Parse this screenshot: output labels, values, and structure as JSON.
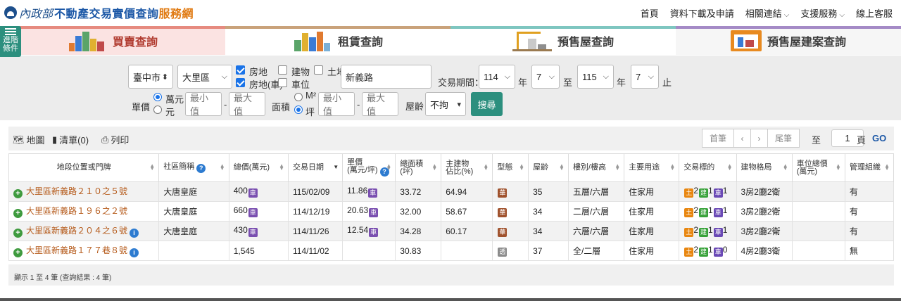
{
  "header": {
    "agency": "內政部",
    "title_main": "不動產交易實價查詢",
    "title_accent": "服務網",
    "nav": [
      {
        "label": "首頁",
        "dropdown": false
      },
      {
        "label": "資料下載及申請",
        "dropdown": false
      },
      {
        "label": "相關連結",
        "dropdown": true
      },
      {
        "label": "支援服務",
        "dropdown": true
      },
      {
        "label": "線上客服",
        "dropdown": false
      }
    ]
  },
  "adv_filter": {
    "line1": "進階",
    "line2": "條件"
  },
  "tabs": [
    {
      "label": "買賣查詢",
      "active": true
    },
    {
      "label": "租賃查詢",
      "active": false
    },
    {
      "label": "預售屋查詢",
      "active": false
    },
    {
      "label": "預售屋建案查詢",
      "active": false
    }
  ],
  "search": {
    "city": "臺中市",
    "district": "大里區",
    "types": {
      "house_land": {
        "label": "房地",
        "checked": true
      },
      "building": {
        "label": "建物",
        "checked": false
      },
      "land": {
        "label": "土地",
        "checked": false
      },
      "house_land_car": {
        "label": "房地(車)",
        "checked": true
      },
      "parking": {
        "label": "車位",
        "checked": false
      }
    },
    "keyword": "新義路",
    "period_label": "交易期間：",
    "from_year": "114",
    "from_month": "7",
    "to_year": "115",
    "to_month": "7",
    "year_suffix": "年",
    "to_word": "至",
    "end_word": "止",
    "price_label": "單價",
    "unit_wan": "萬元",
    "unit_yuan": "元",
    "min_placeholder": "最小值",
    "max_placeholder": "最大值",
    "dash": "-",
    "area_label": "面積",
    "unit_m2": "M²",
    "unit_ping": "坪",
    "age_label": "屋齡",
    "age_value": "不拘",
    "search_button": "搜尋"
  },
  "toolbar": {
    "map": "地圖",
    "list": "清單(0)",
    "print": "列印",
    "first": "首筆",
    "prev": "‹",
    "next": "›",
    "last": "尾筆",
    "goto_label": "至",
    "page": "1",
    "page_suffix": "頁",
    "go": "GO"
  },
  "table": {
    "headers": [
      "地段位置或門牌",
      "社區簡稱",
      "總價(萬元)",
      "交易日期",
      "單價\n(萬元/坪)",
      "總面積\n(坪)",
      "主建物\n佔比(%)",
      "型態",
      "屋齡",
      "樓別/樓高",
      "主要用途",
      "交易標的",
      "建物格局",
      "車位總價\n(萬元)",
      "管理組織"
    ],
    "rows": [
      {
        "address": "大里區新義路２１０之５號",
        "info": false,
        "community": "大唐皇庭",
        "total": "400",
        "car_tag": true,
        "date": "115/02/09",
        "unit": "11.86",
        "unit_tag": true,
        "area": "33.72",
        "ratio": "64.94",
        "type_icon": "華",
        "age": "35",
        "floor": "五層/六層",
        "use": "住家用",
        "land": "2",
        "bldg": "1",
        "car": "1",
        "layout": "3房2廳2衛",
        "car_price": "",
        "mgmt": "有"
      },
      {
        "address": "大里區新義路１９６之２號",
        "info": false,
        "community": "大唐皇庭",
        "total": "660",
        "car_tag": true,
        "date": "114/12/19",
        "unit": "20.63",
        "unit_tag": true,
        "area": "32.00",
        "ratio": "58.67",
        "type_icon": "華",
        "age": "34",
        "floor": "二層/六層",
        "use": "住家用",
        "land": "2",
        "bldg": "1",
        "car": "1",
        "layout": "3房2廳2衛",
        "car_price": "",
        "mgmt": "有"
      },
      {
        "address": "大里區新義路２０４之６號",
        "info": true,
        "community": "大唐皇庭",
        "total": "430",
        "car_tag": true,
        "date": "114/11/26",
        "unit": "12.54",
        "unit_tag": true,
        "area": "34.28",
        "ratio": "60.17",
        "type_icon": "華",
        "age": "34",
        "floor": "六層/六層",
        "use": "住家用",
        "land": "2",
        "bldg": "1",
        "car": "1",
        "layout": "3房2廳2衛",
        "car_price": "",
        "mgmt": "有"
      },
      {
        "address": "大里區新義路１７７巷８號",
        "info": true,
        "community": "",
        "total": "1,545",
        "car_tag": false,
        "date": "114/11/02",
        "unit": "",
        "unit_tag": false,
        "area": "30.83",
        "ratio": "",
        "type_icon": "透",
        "age": "37",
        "floor": "全/二層",
        "use": "住家用",
        "land": "2",
        "bldg": "1",
        "car": "0",
        "layout": "4房2廳3衛",
        "car_price": "",
        "mgmt": "無"
      }
    ],
    "car_tag_label": "車",
    "land_tag_label": "土",
    "bldg_tag_label": "建",
    "car_tag_short": "車"
  },
  "footer": {
    "note": "顯示 1 至 4 筆 (查詢結果 : 4 筆)"
  }
}
